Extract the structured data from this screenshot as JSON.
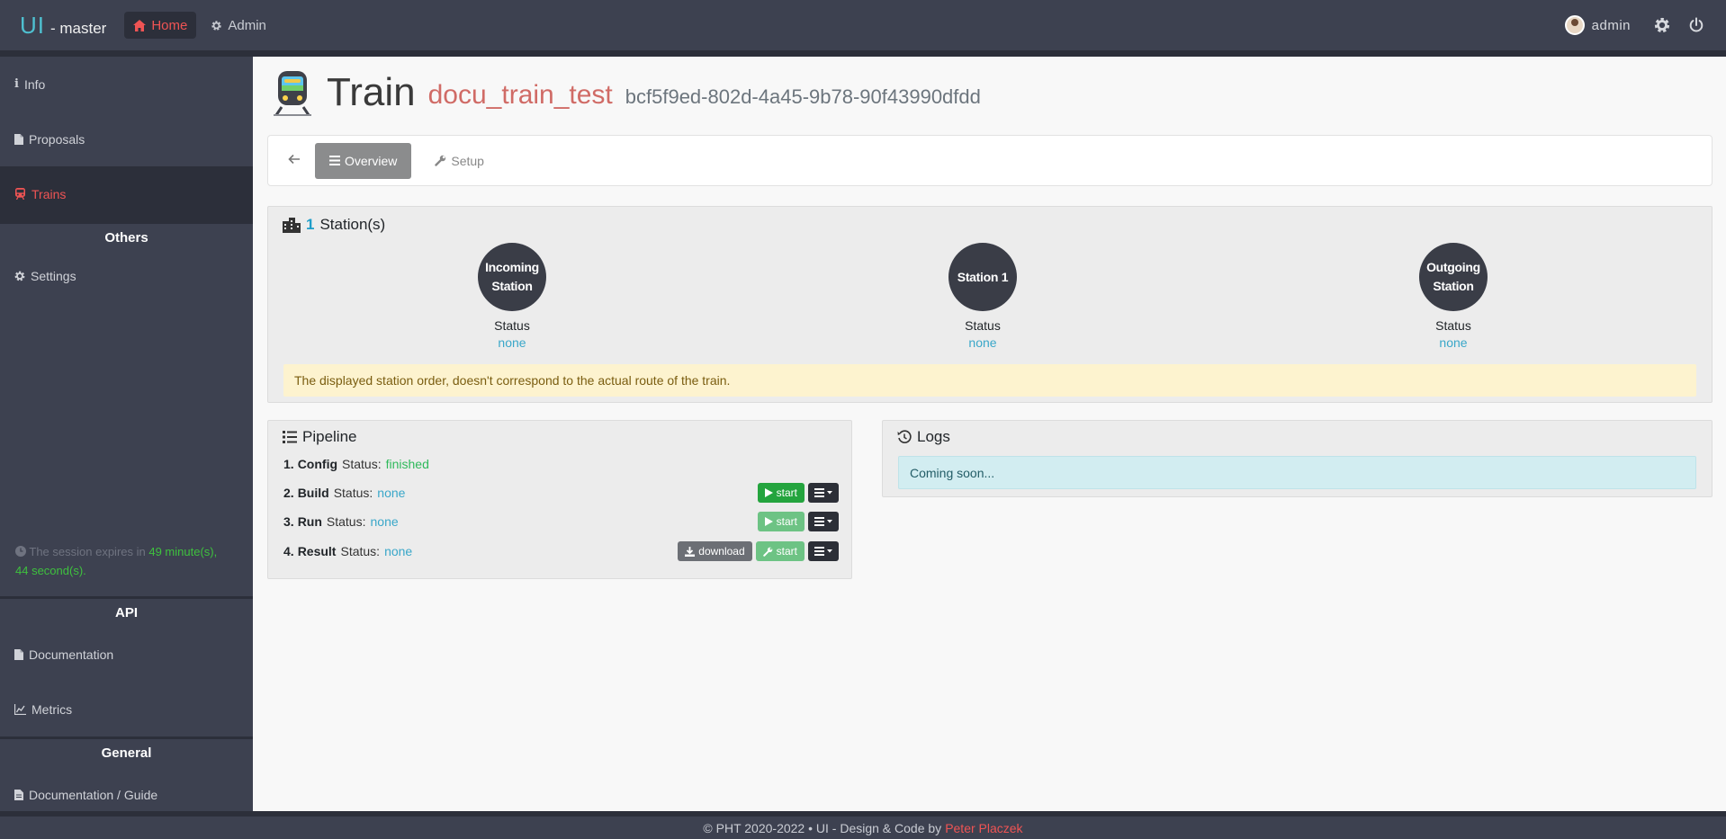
{
  "header": {
    "brand": "UI",
    "env": "- master",
    "nav": [
      {
        "label": "Home",
        "icon": "home-icon",
        "active": true
      },
      {
        "label": "Admin",
        "icon": "gear-icon",
        "active": false
      }
    ],
    "user": "admin"
  },
  "sidebar": {
    "items": [
      {
        "label": "Info",
        "icon": "info-icon"
      },
      {
        "label": "Proposals",
        "icon": "file-icon"
      },
      {
        "label": "Trains",
        "icon": "train-icon",
        "active": true
      }
    ],
    "others_heading": "Others",
    "settings_label": "Settings",
    "session_prefix": "The session expires in",
    "session_time": "49 minute(s), 44 second(s).",
    "api_heading": "API",
    "api_items": [
      {
        "label": "Documentation"
      },
      {
        "label": "Metrics"
      }
    ],
    "general_heading": "General",
    "general_items": [
      {
        "label": "Documentation / Guide"
      }
    ]
  },
  "page": {
    "title": "Train",
    "train_name": "docu_train_test",
    "train_id": "bcf5f9ed-802d-4a45-9b78-90f43990dfdd",
    "tabs": [
      {
        "label": "Overview",
        "active": true
      },
      {
        "label": "Setup",
        "active": false
      }
    ]
  },
  "stations": {
    "count": "1",
    "title_suffix": "Station(s)",
    "list": [
      {
        "line1": "Incoming",
        "line2": "Station",
        "status_label": "Status",
        "status": "none"
      },
      {
        "line1": "Station 1",
        "line2": "",
        "status_label": "Status",
        "status": "none"
      },
      {
        "line1": "Outgoing",
        "line2": "Station",
        "status_label": "Status",
        "status": "none"
      }
    ],
    "warning": "The displayed station order, doesn't correspond to the actual route of the train."
  },
  "pipeline": {
    "title": "Pipeline",
    "status_label": "Status:",
    "steps": [
      {
        "number": "1.",
        "name": "Config",
        "status": "finished"
      },
      {
        "number": "2.",
        "name": "Build",
        "status": "none"
      },
      {
        "number": "3.",
        "name": "Run",
        "status": "none"
      },
      {
        "number": "4.",
        "name": "Result",
        "status": "none"
      }
    ],
    "start_label": "start",
    "download_label": "download"
  },
  "logs": {
    "title": "Logs",
    "message": "Coming soon..."
  },
  "footer": {
    "text": "© PHT 2020-2022 • UI - Design & Code by",
    "author": "Peter Placzek"
  },
  "colors": {
    "accent": "#ef5454",
    "info": "#3aa7c9",
    "success": "#24a43e",
    "sidebar_bg": "#3d4150"
  }
}
